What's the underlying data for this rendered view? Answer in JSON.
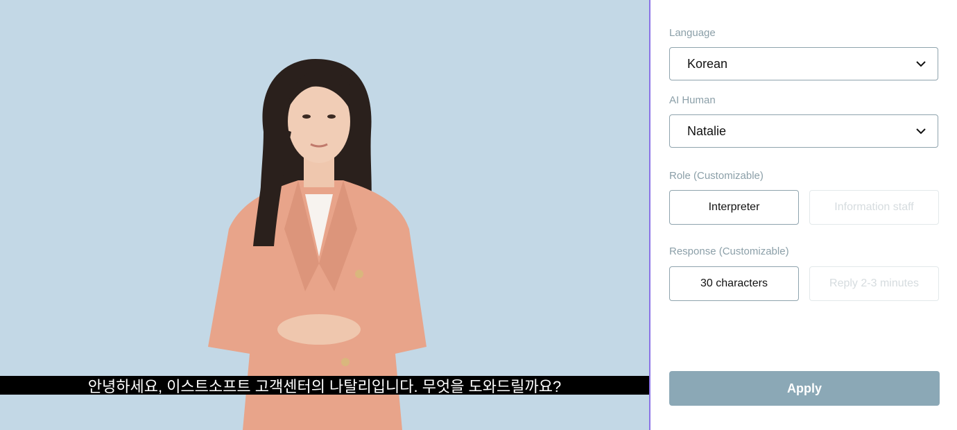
{
  "stage": {
    "subtitle": "안녕하세요, 이스트소프트 고객센터의 나탈리입니다. 무엇을 도와드릴까요?"
  },
  "panel": {
    "language": {
      "label": "Language",
      "value": "Korean"
    },
    "ai_human": {
      "label": "AI Human",
      "value": "Natalie"
    },
    "role": {
      "label": "Role (Customizable)",
      "options": [
        "Interpreter",
        "Information staff"
      ],
      "selected": "Interpreter"
    },
    "response": {
      "label": "Response (Customizable)",
      "options": [
        "30 characters",
        "Reply 2-3 minutes"
      ],
      "selected": "30 characters"
    },
    "apply_label": "Apply"
  },
  "colors": {
    "stage_background": "#c3d8e6",
    "divider": "#8b73e6",
    "apply_button": "#8ba8b6",
    "label_text": "#8b9fa8"
  },
  "icons": {
    "select_arrow": "chevron-down-icon"
  }
}
